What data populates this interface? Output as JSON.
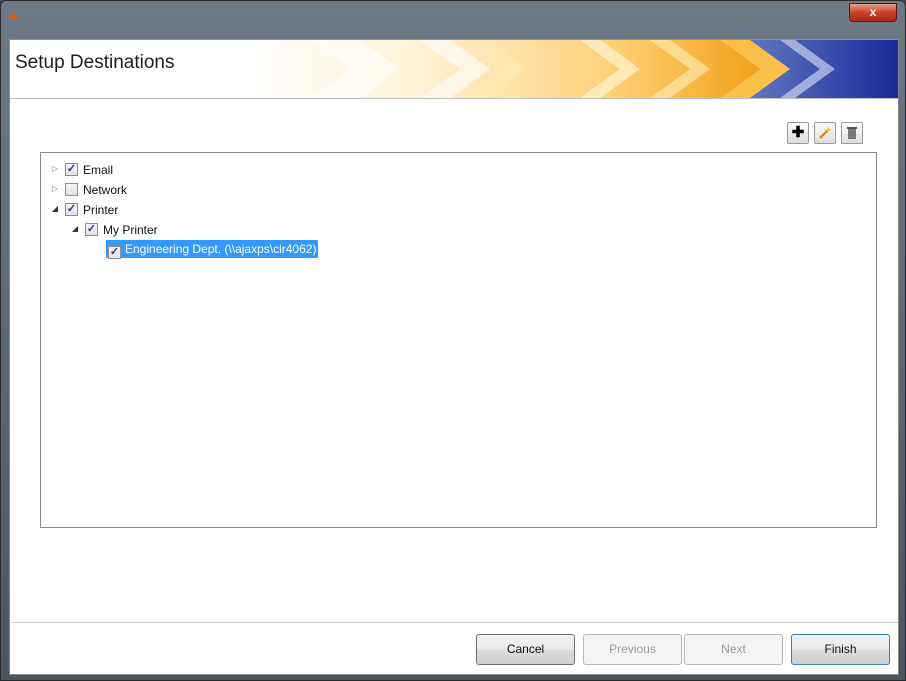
{
  "window": {
    "icon": "app-logo-icon",
    "close_glyph": "x"
  },
  "header": {
    "title": "Setup Destinations"
  },
  "toolbar": {
    "add_icon": "+",
    "edit_icon": "wand",
    "delete_icon": "trash"
  },
  "tree": {
    "nodes": [
      {
        "label": "Email",
        "checked": true,
        "expander": "collapsed"
      },
      {
        "label": "Network",
        "checked": false,
        "expander": "collapsed"
      },
      {
        "label": "Printer",
        "checked": true,
        "expander": "expanded"
      },
      {
        "label": "My Printer",
        "checked": true,
        "expander": "expanded"
      },
      {
        "label": "Engineering Dept. (\\\\ajaxps\\clr4062)",
        "checked": true,
        "selected": true
      }
    ]
  },
  "buttons": {
    "cancel": "Cancel",
    "previous": "Previous",
    "next": "Next",
    "finish": "Finish"
  },
  "colors": {
    "selection": "#3399ff",
    "banner_orange": "#f5a623",
    "banner_blue": "#1a2a9a"
  }
}
